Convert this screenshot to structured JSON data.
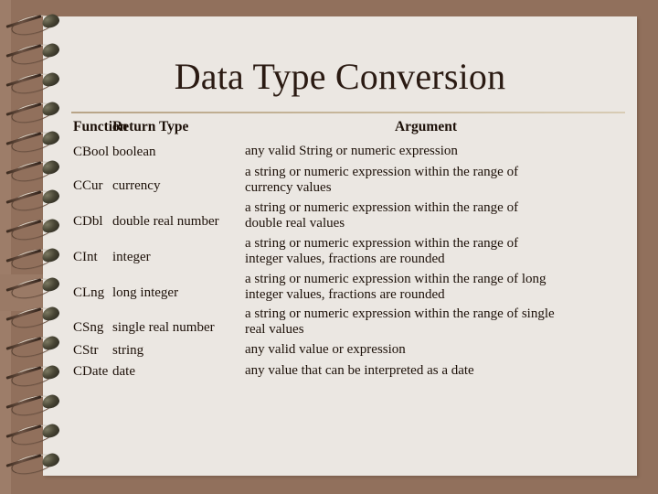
{
  "slide": {
    "title": "Data Type Conversion",
    "background_color": "#91705c",
    "page_color": "#ebe7e2",
    "title_color": "#2a1a12",
    "rule_color": "#c4b49a",
    "binding": "spiral-notebook-rings",
    "ring_count": 16
  },
  "table": {
    "headers": {
      "function": "Function",
      "return_type": "Return Type",
      "argument": "Argument"
    },
    "rows": [
      {
        "function": "CBool",
        "return_type": "boolean",
        "argument": "any valid String or numeric expression",
        "argument_lines": [
          "any valid String or numeric expression"
        ]
      },
      {
        "function": "CCur",
        "return_type": "currency",
        "argument": "a string or numeric expression within the range of currency values",
        "argument_lines": [
          "a string or numeric expression within the range of",
          "currency values"
        ]
      },
      {
        "function": "CDbl",
        "return_type": "double real number",
        "argument": "a string or numeric expression within the range of double real values",
        "argument_lines": [
          "a string or numeric expression within the range of",
          "double real values"
        ]
      },
      {
        "function": "CInt",
        "return_type": "integer",
        "argument": "a string or numeric expression within the range of integer values, fractions are rounded",
        "argument_lines": [
          "a string or numeric expression within the range of",
          "integer values, fractions are rounded"
        ]
      },
      {
        "function": "CLng",
        "return_type": "long integer",
        "argument": "a string or numeric expression within the range of long integer values, fractions are rounded",
        "argument_lines": [
          "a string or numeric expression within the range of long",
          "integer values, fractions are rounded"
        ]
      },
      {
        "function": "CSng",
        "return_type": "single real number",
        "argument": "a string or numeric expression within the range of single real values",
        "argument_lines": [
          "a string or numeric expression within the range of single",
          "real values"
        ]
      },
      {
        "function": "CStr",
        "return_type": "string",
        "argument": "any valid value or expression",
        "argument_lines": [
          "any valid value or expression"
        ]
      },
      {
        "function": "CDate",
        "return_type": "date",
        "argument": "any value that can be interpreted as a date",
        "argument_lines": [
          "any value that can be interpreted as a date"
        ]
      }
    ]
  }
}
